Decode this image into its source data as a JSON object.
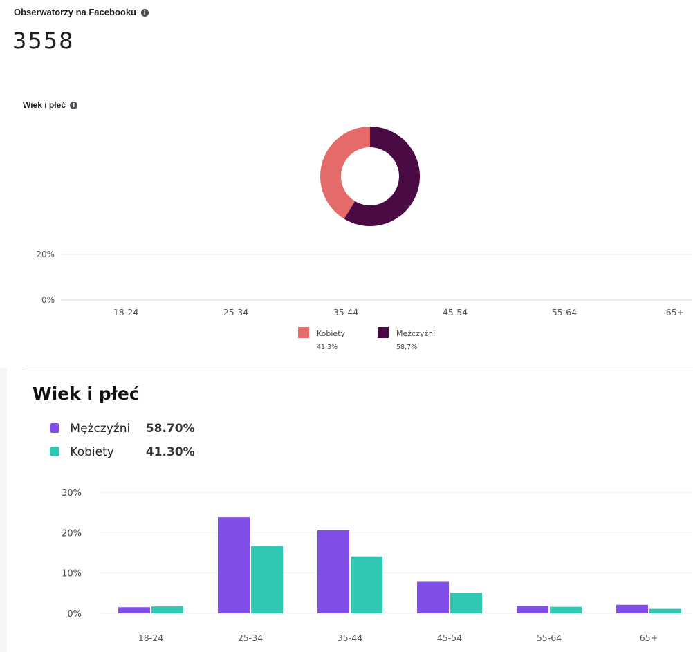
{
  "followers": {
    "title": "Obserwatorzy na Facebooku",
    "info_icon": "i",
    "count": "3558"
  },
  "top_section": {
    "title": "Wiek i płeć",
    "info_icon": "i"
  },
  "bottom_section": {
    "title": "Wiek i płeć",
    "legend": [
      {
        "label": "Mężczyźni",
        "value": "58.70%",
        "color": "#7f4ee6"
      },
      {
        "label": "Kobiety",
        "value": "41.30%",
        "color": "#2ec8b2"
      }
    ]
  },
  "chart_data": [
    {
      "type": "pie",
      "style": "donut",
      "title": "Wiek i płeć",
      "series": [
        {
          "name": "Kobiety",
          "value": 41.3,
          "label": "41,3%",
          "color": "#e56b6b"
        },
        {
          "name": "Mężczyźni",
          "value": 58.7,
          "label": "58,7%",
          "color": "#4a0b45"
        }
      ]
    },
    {
      "type": "bar",
      "title": "",
      "categories": [
        "18-24",
        "25-34",
        "35-44",
        "45-54",
        "55-64",
        "65+"
      ],
      "series": [],
      "yticks": [
        "20%",
        "0%"
      ],
      "ylim": [
        0,
        20
      ],
      "legend": [
        {
          "name": "Kobiety",
          "value": "41,3%",
          "color": "#e56b6b"
        },
        {
          "name": "Mężczyźni",
          "value": "58,7%",
          "color": "#4a0b45"
        }
      ]
    },
    {
      "type": "bar",
      "title": "Wiek i płeć",
      "categories": [
        "18-24",
        "25-34",
        "35-44",
        "45-54",
        "55-64",
        "65+"
      ],
      "series": [
        {
          "name": "Mężczyźni",
          "color": "#7f4ee6",
          "values": [
            1.5,
            23.8,
            20.6,
            7.8,
            1.8,
            2.1
          ]
        },
        {
          "name": "Kobiety",
          "color": "#2ec8b2",
          "values": [
            1.7,
            16.7,
            14.1,
            5.1,
            1.6,
            1.1
          ]
        }
      ],
      "yticks": [
        "30%",
        "20%",
        "10%",
        "0%"
      ],
      "ylim": [
        0,
        30
      ],
      "grid": true
    }
  ]
}
